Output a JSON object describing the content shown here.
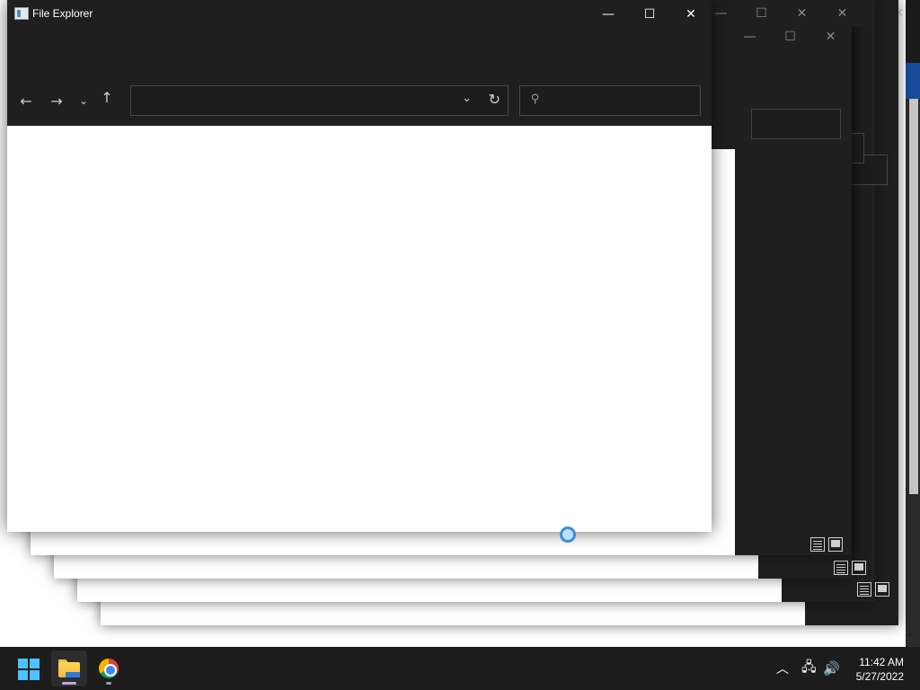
{
  "window": {
    "title": "File Explorer",
    "caption": {
      "minimize": "—",
      "maximize": "☐",
      "close": "✕"
    }
  },
  "nav": {
    "back_icon": "←",
    "forward_icon": "→",
    "recent_icon": "⌄",
    "up_icon": "↑"
  },
  "address_bar": {
    "value": "",
    "dropdown_icon": "⌄",
    "refresh_icon": "↻"
  },
  "search": {
    "placeholder": "",
    "icon": "⚲"
  },
  "background_windows": {
    "caption": {
      "minimize": "—",
      "maximize": "☐",
      "close": "✕"
    },
    "menu_icon": "⋮",
    "scroll_down_icon": "▾"
  },
  "taskbar": {
    "apps": [
      "Start",
      "File Explorer",
      "Google Chrome"
    ],
    "tray": {
      "chevron_icon": "︿",
      "network_icon": "🖧",
      "volume_icon": "🔊"
    },
    "time": "11:42 AM",
    "date": "5/27/2022"
  },
  "colors": {
    "titlebar": "#1f1f1f",
    "taskbar": "#1c1c1c",
    "accent": "#4cc2ff",
    "busy_cursor": "#3a8fd8"
  }
}
